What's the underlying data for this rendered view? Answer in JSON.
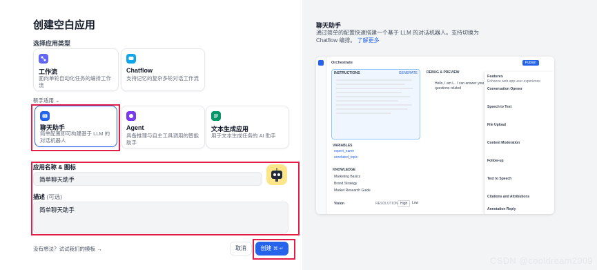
{
  "title": "创建空白应用",
  "section_type": "选择应用类型",
  "types_top": [
    {
      "name": "工作流",
      "desc": "面向单轮自动化任务的编排工作流",
      "color": "#6366f1"
    },
    {
      "name": "Chatflow",
      "desc": "支持记忆的复杂多轮对话工作流",
      "color": "#0ea5e9"
    }
  ],
  "beginner_toggle": "新手适用",
  "types_bottom": [
    {
      "name": "聊天助手",
      "desc": "简单配置即可构建基于 LLM 的对话机器人",
      "color": "#2563eb"
    },
    {
      "name": "Agent",
      "desc": "具备推理与自主工具调用的智能助手",
      "color": "#7c3aed"
    },
    {
      "name": "文本生成应用",
      "desc": "用于文本生成任务的 AI 助手",
      "color": "#059669"
    }
  ],
  "form": {
    "name_label": "应用名称 & 图标",
    "name_value": "简单聊天助手",
    "desc_label": "描述",
    "desc_optional": "(可选)",
    "desc_value": "简单聊天助手"
  },
  "footer": {
    "template_link": "没有想法？试试我们的模板",
    "cancel": "取消",
    "create": "创建",
    "shortcut": "⌘ ↵"
  },
  "right_panel": {
    "title": "聊天助手",
    "desc": "通过简单的配置快速搭建一个基于 LLM 的对话机器人。支持切换为 Chatflow 编排。",
    "link": "了解更多",
    "preview": {
      "header": "Orchestrate",
      "instructions": "INSTRUCTIONS",
      "generate": "GENERATE",
      "debug": "DEBUG & PREVIEW",
      "publish": "Publish",
      "variables": "VARIABLES",
      "knowledge": "KNOWLEDGE",
      "vision": "Vision",
      "resolution": "RESOLUTION",
      "high": "High",
      "low": "Low",
      "var_rows": [
        "expert_name",
        "unrelated_topic"
      ],
      "kb_rows": [
        "Marketing Basics",
        "Brand Strategy",
        "Market Research Guide"
      ],
      "greeting": "Hello, I am L.. I can answer your questions related",
      "features_title": "Features",
      "features_sub": "Enhance web app user experience",
      "features": [
        "Conversation Opener",
        "Speech to Text",
        "File Upload",
        "Content Moderation",
        "Follow-up",
        "Text to Speech",
        "Citations and Attributions",
        "Annotation Reply"
      ]
    }
  },
  "watermark": "CSDN @cooldream2009"
}
